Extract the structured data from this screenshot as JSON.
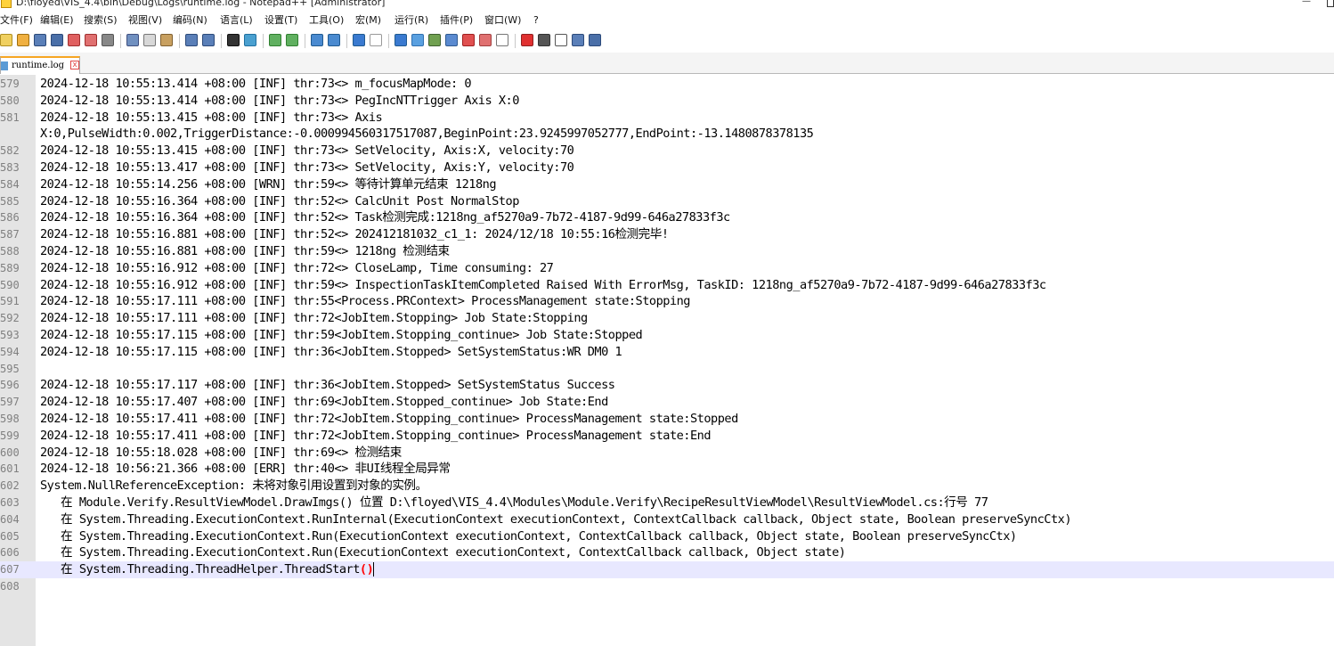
{
  "window": {
    "title": "D:\\floyed\\VIS_4.4\\bin\\Debug\\Logs\\runtime.log - Notepad++ [Administrator]"
  },
  "menu": [
    "文件(F)",
    "编辑(E)",
    "搜索(S)",
    "视图(V)",
    "编码(N)",
    "语言(L)",
    "设置(T)",
    "工具(O)",
    "宏(M)",
    "运行(R)",
    "插件(P)",
    "窗口(W)",
    "?"
  ],
  "tab": {
    "label": "runtime.log",
    "close_icon": "close-icon"
  },
  "colors": {
    "tab_accent": "#f6a623",
    "current_line": "#e8e8ff",
    "gutter": "#e4e4e4",
    "brace_highlight": "#ff0000"
  },
  "editor": {
    "lines": [
      {
        "n": "579",
        "text": "2024-12-18 10:55:13.414 +08:00 [INF] thr:73<> m_focusMapMode: 0"
      },
      {
        "n": "580",
        "text": "2024-12-18 10:55:13.414 +08:00 [INF] thr:73<> PegIncNTTrigger Axis X:0"
      },
      {
        "n": "581",
        "text": "2024-12-18 10:55:13.415 +08:00 [INF] thr:73<> Axis"
      },
      {
        "n": "",
        "text": "X:0,PulseWidth:0.002,TriggerDistance:-0.000994560317517087,BeginPoint:23.9245997052777,EndPoint:-13.1480878378135"
      },
      {
        "n": "582",
        "text": "2024-12-18 10:55:13.415 +08:00 [INF] thr:73<> SetVelocity, Axis:X, velocity:70"
      },
      {
        "n": "583",
        "text": "2024-12-18 10:55:13.417 +08:00 [INF] thr:73<> SetVelocity, Axis:Y, velocity:70"
      },
      {
        "n": "584",
        "text": "2024-12-18 10:55:14.256 +08:00 [WRN] thr:59<> 等待计算单元结束 1218ng"
      },
      {
        "n": "585",
        "text": "2024-12-18 10:55:16.364 +08:00 [INF] thr:52<> CalcUnit Post NormalStop"
      },
      {
        "n": "586",
        "text": "2024-12-18 10:55:16.364 +08:00 [INF] thr:52<> Task检测完成:1218ng_af5270a9-7b72-4187-9d99-646a27833f3c"
      },
      {
        "n": "587",
        "text": "2024-12-18 10:55:16.881 +08:00 [INF] thr:52<> 202412181032_c1_1: 2024/12/18 10:55:16检测完毕!"
      },
      {
        "n": "588",
        "text": "2024-12-18 10:55:16.881 +08:00 [INF] thr:59<> 1218ng 检测结束"
      },
      {
        "n": "589",
        "text": "2024-12-18 10:55:16.912 +08:00 [INF] thr:72<> CloseLamp, Time consuming: 27"
      },
      {
        "n": "590",
        "text": "2024-12-18 10:55:16.912 +08:00 [INF] thr:59<> InspectionTaskItemCompleted Raised With ErrorMsg, TaskID: 1218ng_af5270a9-7b72-4187-9d99-646a27833f3c"
      },
      {
        "n": "591",
        "text": "2024-12-18 10:55:17.111 +08:00 [INF] thr:55<Process.PRContext> ProcessManagement state:Stopping"
      },
      {
        "n": "592",
        "text": "2024-12-18 10:55:17.111 +08:00 [INF] thr:72<JobItem.Stopping> Job State:Stopping"
      },
      {
        "n": "593",
        "text": "2024-12-18 10:55:17.115 +08:00 [INF] thr:59<JobItem.Stopping_continue> Job State:Stopped"
      },
      {
        "n": "594",
        "text": "2024-12-18 10:55:17.115 +08:00 [INF] thr:36<JobItem.Stopped> SetSystemStatus:WR DM0 1"
      },
      {
        "n": "595",
        "text": ""
      },
      {
        "n": "596",
        "text": "2024-12-18 10:55:17.117 +08:00 [INF] thr:36<JobItem.Stopped> SetSystemStatus Success"
      },
      {
        "n": "597",
        "text": "2024-12-18 10:55:17.407 +08:00 [INF] thr:69<JobItem.Stopped_continue> Job State:End"
      },
      {
        "n": "598",
        "text": "2024-12-18 10:55:17.411 +08:00 [INF] thr:72<JobItem.Stopping_continue> ProcessManagement state:Stopped"
      },
      {
        "n": "599",
        "text": "2024-12-18 10:55:17.411 +08:00 [INF] thr:72<JobItem.Stopping_continue> ProcessManagement state:End"
      },
      {
        "n": "600",
        "text": "2024-12-18 10:55:18.028 +08:00 [INF] thr:69<> 检测结束"
      },
      {
        "n": "601",
        "text": "2024-12-18 10:56:21.366 +08:00 [ERR] thr:40<> 非UI线程全局异常"
      },
      {
        "n": "602",
        "text": "System.NullReferenceException: 未将对象引用设置到对象的实例。"
      },
      {
        "n": "603",
        "text": "   在 Module.Verify.ResultViewModel.DrawImgs() 位置 D:\\floyed\\VIS_4.4\\Modules\\Module.Verify\\RecipeResultViewModel\\ResultViewModel.cs:行号 77"
      },
      {
        "n": "604",
        "text": "   在 System.Threading.ExecutionContext.RunInternal(ExecutionContext executionContext, ContextCallback callback, Object state, Boolean preserveSyncCtx)"
      },
      {
        "n": "605",
        "text": "   在 System.Threading.ExecutionContext.Run(ExecutionContext executionContext, ContextCallback callback, Object state, Boolean preserveSyncCtx)"
      },
      {
        "n": "606",
        "text": "   在 System.Threading.ExecutionContext.Run(ExecutionContext executionContext, ContextCallback callback, Object state)"
      },
      {
        "n": "607",
        "text": "   在 System.Threading.ThreadHelper.ThreadStart",
        "suffix": "()",
        "current": true
      },
      {
        "n": "608",
        "text": ""
      }
    ]
  }
}
